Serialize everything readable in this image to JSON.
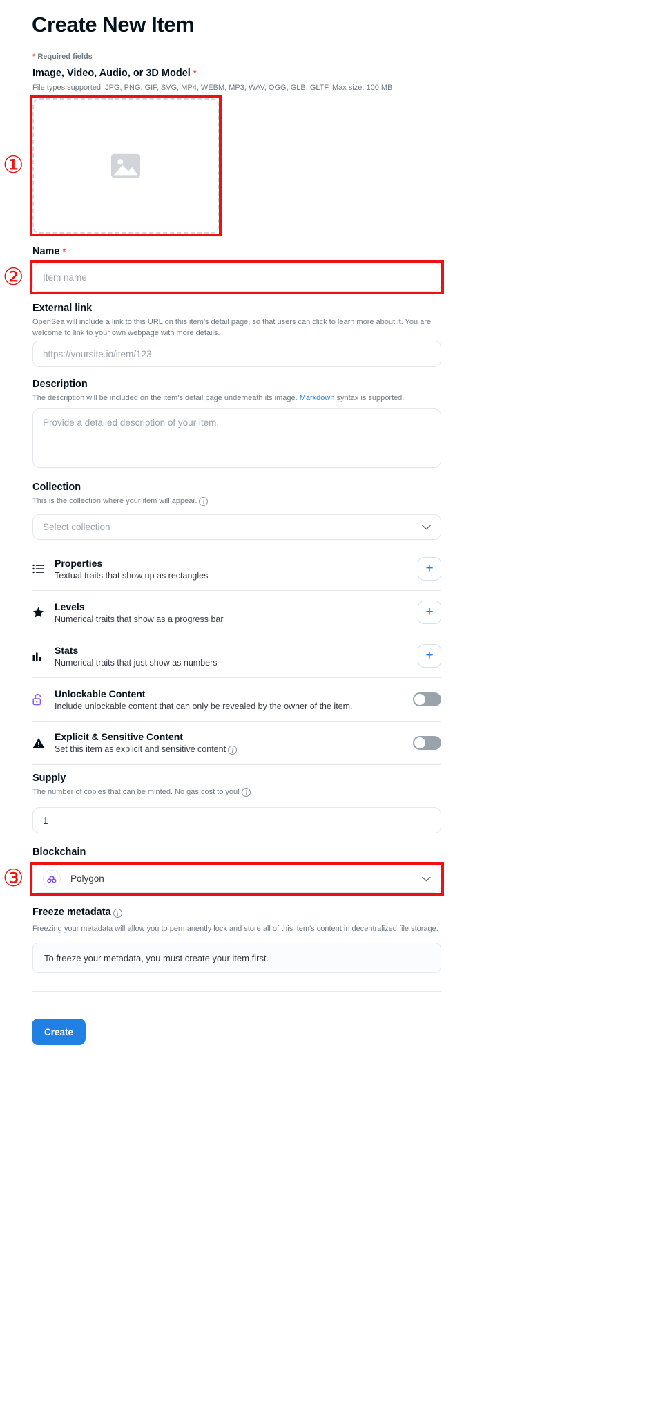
{
  "page": {
    "title": "Create New Item",
    "required_note": "Required fields",
    "required_star": "*"
  },
  "media": {
    "label": "Image, Video, Audio, or 3D Model",
    "required_star": "*",
    "help": "File types supported: JPG, PNG, GIF, SVG, MP4, WEBM, MP3, WAV, OGG, GLB, GLTF. Max size: 100 MB",
    "icon": "image-placeholder-icon"
  },
  "name": {
    "label": "Name",
    "required_star": "*",
    "placeholder": "Item name",
    "value": ""
  },
  "external_link": {
    "label": "External link",
    "help": "OpenSea will include a link to this URL on this item's detail page, so that users can click to learn more about it. You are welcome to link to your own webpage with more details.",
    "placeholder": "https://yoursite.io/item/123",
    "value": ""
  },
  "description": {
    "label": "Description",
    "help_before": "The description will be included on the item's detail page underneath its image. ",
    "help_link": "Markdown",
    "help_after": " syntax is supported.",
    "placeholder": "Provide a detailed description of your item.",
    "value": ""
  },
  "collection": {
    "label": "Collection",
    "help": "This is the collection where your item will appear.",
    "placeholder": "Select collection",
    "value": "",
    "chevron": "chevron-down-icon"
  },
  "traits": [
    {
      "title": "Properties",
      "subtitle": "Textual traits that show up as rectangles",
      "icon": "list-icon",
      "action": "add-button",
      "action_label": "+"
    },
    {
      "title": "Levels",
      "subtitle": "Numerical traits that show as a progress bar",
      "icon": "star-icon",
      "action": "add-button",
      "action_label": "+"
    },
    {
      "title": "Stats",
      "subtitle": "Numerical traits that just show as numbers",
      "icon": "bar-chart-icon",
      "action": "add-button",
      "action_label": "+"
    }
  ],
  "toggles": [
    {
      "title": "Unlockable Content",
      "subtitle": "Include unlockable content that can only be revealed by the owner of the item.",
      "icon": "unlock-icon",
      "state": "off",
      "has_info": false
    },
    {
      "title": "Explicit & Sensitive Content",
      "subtitle": "Set this item as explicit and sensitive content",
      "icon": "warning-triangle-icon",
      "state": "off",
      "has_info": true
    }
  ],
  "supply": {
    "label": "Supply",
    "help": "The number of copies that can be minted. No gas cost to you!",
    "value": "1"
  },
  "blockchain": {
    "label": "Blockchain",
    "value": "Polygon",
    "icon": "polygon-logo-icon",
    "chevron": "chevron-down-icon"
  },
  "freeze": {
    "label": "Freeze metadata",
    "help": "Freezing your metadata will allow you to permanently lock and store all of this item's content in decentralized file storage.",
    "note": "To freeze your metadata, you must create your item first."
  },
  "submit": {
    "label": "Create"
  },
  "annotations": [
    {
      "marker": "①",
      "target": "media-dropzone"
    },
    {
      "marker": "②",
      "target": "name-input"
    },
    {
      "marker": "③",
      "target": "blockchain-select"
    }
  ],
  "colors": {
    "accent": "#2081e2",
    "annotation": "#ee1111",
    "required": "#eb5757",
    "text": "#04111d",
    "muted": "#707a83"
  }
}
